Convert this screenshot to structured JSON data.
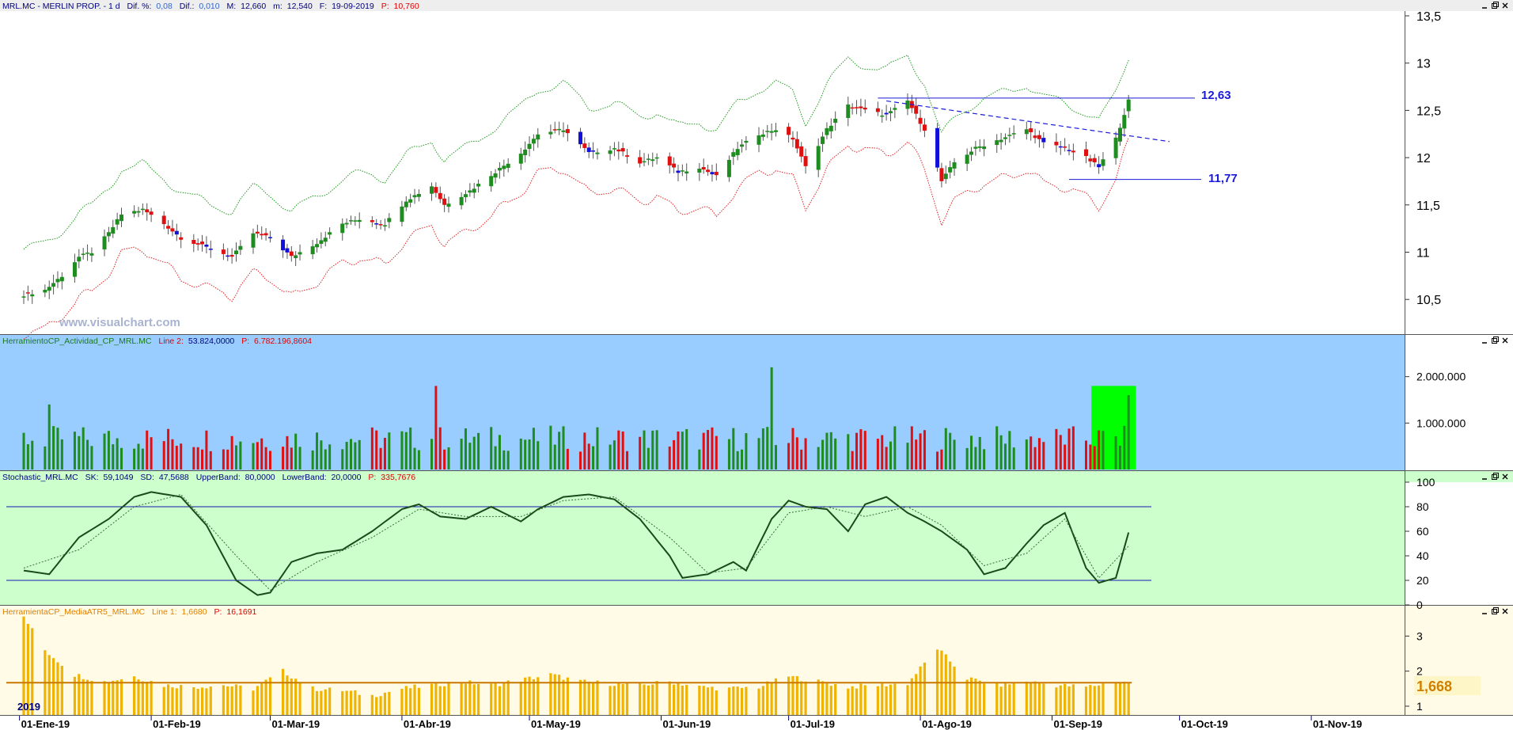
{
  "colors": {
    "up": "#1e8c1e",
    "down": "#e01010",
    "blue_candle": "#1010d8",
    "upper_band": "#1f9a1f",
    "lower_band": "#e02020",
    "trendline": "#1a1ad8",
    "volume_bg": "#99ccff",
    "stoch_bg": "#ccffcc",
    "atr_bg": "#fffbe6",
    "atr_bar": "#f0b400",
    "atr_line": "#c87800",
    "highlight": "#00ff00"
  },
  "icons": [
    "minimize-icon",
    "restore-icon",
    "close-icon"
  ],
  "panels": {
    "price": {
      "header": {
        "symbol": "MRL.MC - MERLIN PROP. - 1 d",
        "dif_pct_label": "Dif. %:",
        "dif_pct": "0,08",
        "dif_label": "Dif.:",
        "dif": "0,010",
        "max_label": "M:",
        "max": "12,660",
        "min_label": "m:",
        "min": "12,540",
        "date_label": "F:",
        "date": "19-09-2019",
        "p_label": "P:",
        "p": "10,760"
      },
      "watermark": "www.visualchart.com",
      "level_high": "12,63",
      "level_low": "11,77"
    },
    "volume": {
      "header": {
        "name": "HerramientoCP_Actividad_CP_MRL.MC",
        "line_label": "Line 2:",
        "line": "53.824,0000",
        "p_label": "P:",
        "p": "6.782.196,8604"
      },
      "ticks": [
        "2.000.000",
        "1.000.000"
      ]
    },
    "stochastic": {
      "header": {
        "name": "Stochastic_MRL.MC",
        "sk_label": "SK:",
        "sk": "59,1049",
        "sd_label": "SD:",
        "sd": "47,5688",
        "ub_label": "UpperBand:",
        "ub": "80,0000",
        "lb_label": "LowerBand:",
        "lb": "20,0000",
        "p_label": "P:",
        "p": "335,7676"
      },
      "ticks": [
        "100",
        "80",
        "60",
        "40",
        "20",
        "0"
      ]
    },
    "atr": {
      "header": {
        "name": "HerramientaCP_MediaATR5_MRL.MC",
        "line_label": "Line 1:",
        "line": "1,6680",
        "p_label": "P:",
        "p": "16,1691"
      },
      "ticks": [
        "3",
        "2",
        "1"
      ],
      "current_value": "1,668",
      "year_label": "2019"
    }
  },
  "x_axis": {
    "labels": [
      "01-Ene-19",
      "01-Feb-19",
      "01-Mar-19",
      "01-Abr-19",
      "01-May-19",
      "01-Jun-19",
      "01-Jul-19",
      "01-Ago-19",
      "01-Sep-19",
      "01-Oct-19",
      "01-Nov-19"
    ]
  },
  "chart_data": [
    {
      "type": "candlestick",
      "panel": "price",
      "y_ticks": [
        "13,5",
        "13",
        "12,5",
        "12",
        "11,5",
        "11",
        "10,5"
      ],
      "ylim": [
        10.15,
        13.5
      ],
      "x_range": [
        "2019-01-02",
        "2019-11-05"
      ],
      "horizontal_levels": [
        12.63,
        11.77
      ],
      "ohlc_points": [
        [
          "2019-01-02",
          10.55
        ],
        [
          "2019-01-07",
          10.6
        ],
        [
          "2019-01-11",
          10.75
        ],
        [
          "2019-01-15",
          10.95
        ],
        [
          "2019-01-18",
          11.0
        ],
        [
          "2019-01-22",
          11.2
        ],
        [
          "2019-01-25",
          11.4
        ],
        [
          "2019-01-30",
          11.45
        ],
        [
          "2019-02-04",
          11.3
        ],
        [
          "2019-02-08",
          11.15
        ],
        [
          "2019-02-14",
          11.05
        ],
        [
          "2019-02-20",
          10.95
        ],
        [
          "2019-02-25",
          11.2
        ],
        [
          "2019-03-01",
          11.15
        ],
        [
          "2019-03-06",
          10.95
        ],
        [
          "2019-03-12",
          11.1
        ],
        [
          "2019-03-18",
          11.3
        ],
        [
          "2019-03-22",
          11.35
        ],
        [
          "2019-03-28",
          11.3
        ],
        [
          "2019-04-02",
          11.55
        ],
        [
          "2019-04-08",
          11.7
        ],
        [
          "2019-04-11",
          11.5
        ],
        [
          "2019-04-17",
          11.65
        ],
        [
          "2019-04-23",
          11.85
        ],
        [
          "2019-04-29",
          12.05
        ],
        [
          "2019-05-03",
          12.25
        ],
        [
          "2019-05-09",
          12.3
        ],
        [
          "2019-05-15",
          12.05
        ],
        [
          "2019-05-21",
          12.1
        ],
        [
          "2019-05-27",
          11.95
        ],
        [
          "2019-05-31",
          12.0
        ],
        [
          "2019-06-05",
          11.85
        ],
        [
          "2019-06-10",
          11.9
        ],
        [
          "2019-06-14",
          11.8
        ],
        [
          "2019-06-19",
          12.1
        ],
        [
          "2019-06-24",
          12.25
        ],
        [
          "2019-06-28",
          12.3
        ],
        [
          "2019-07-02",
          12.2
        ],
        [
          "2019-07-05",
          11.9
        ],
        [
          "2019-07-10",
          12.3
        ],
        [
          "2019-07-15",
          12.55
        ],
        [
          "2019-07-19",
          12.5
        ],
        [
          "2019-07-24",
          12.45
        ],
        [
          "2019-07-29",
          12.6
        ],
        [
          "2019-08-02",
          12.3
        ],
        [
          "2019-08-06",
          11.75
        ],
        [
          "2019-08-09",
          11.95
        ],
        [
          "2019-08-14",
          12.1
        ],
        [
          "2019-08-20",
          12.2
        ],
        [
          "2019-08-26",
          12.3
        ],
        [
          "2019-08-30",
          12.15
        ],
        [
          "2019-09-04",
          12.1
        ],
        [
          "2019-09-09",
          12.0
        ],
        [
          "2019-09-12",
          11.9
        ],
        [
          "2019-09-16",
          12.2
        ],
        [
          "2019-09-19",
          12.6
        ]
      ],
      "last_bar": {
        "date": "2019-09-19",
        "high": 12.66,
        "low": 12.54
      }
    },
    {
      "type": "bar",
      "panel": "volume",
      "ylim": [
        0,
        3000000
      ],
      "y_ticks": [
        2000000,
        1000000
      ],
      "typical_volume": 700000,
      "notable_spikes": [
        {
          "date": "2019-06-27",
          "value": 2200000
        },
        {
          "date": "2019-04-09",
          "value": 1800000
        },
        {
          "date": "2019-01-08",
          "value": 1400000
        }
      ],
      "highlight_range": [
        "2019-09-11",
        "2019-09-20"
      ],
      "last_value": 1600000
    },
    {
      "type": "line",
      "panel": "stochastic",
      "ylim": [
        0,
        100
      ],
      "bands": [
        80,
        20
      ],
      "series": [
        {
          "name": "SK",
          "points": [
            [
              "2019-01-02",
              28
            ],
            [
              "2019-01-08",
              25
            ],
            [
              "2019-01-15",
              55
            ],
            [
              "2019-01-22",
              70
            ],
            [
              "2019-01-28",
              88
            ],
            [
              "2019-02-01",
              92
            ],
            [
              "2019-02-08",
              88
            ],
            [
              "2019-02-14",
              65
            ],
            [
              "2019-02-21",
              20
            ],
            [
              "2019-02-26",
              8
            ],
            [
              "2019-03-01",
              10
            ],
            [
              "2019-03-06",
              35
            ],
            [
              "2019-03-12",
              42
            ],
            [
              "2019-03-18",
              45
            ],
            [
              "2019-03-25",
              60
            ],
            [
              "2019-04-01",
              78
            ],
            [
              "2019-04-05",
              82
            ],
            [
              "2019-04-10",
              72
            ],
            [
              "2019-04-16",
              70
            ],
            [
              "2019-04-22",
              80
            ],
            [
              "2019-04-29",
              68
            ],
            [
              "2019-05-03",
              78
            ],
            [
              "2019-05-09",
              88
            ],
            [
              "2019-05-15",
              90
            ],
            [
              "2019-05-21",
              86
            ],
            [
              "2019-05-27",
              70
            ],
            [
              "2019-06-03",
              40
            ],
            [
              "2019-06-06",
              22
            ],
            [
              "2019-06-12",
              25
            ],
            [
              "2019-06-18",
              35
            ],
            [
              "2019-06-21",
              28
            ],
            [
              "2019-06-27",
              70
            ],
            [
              "2019-07-01",
              85
            ],
            [
              "2019-07-05",
              80
            ],
            [
              "2019-07-10",
              78
            ],
            [
              "2019-07-15",
              60
            ],
            [
              "2019-07-19",
              82
            ],
            [
              "2019-07-24",
              88
            ],
            [
              "2019-07-29",
              75
            ],
            [
              "2019-08-02",
              68
            ],
            [
              "2019-08-06",
              60
            ],
            [
              "2019-08-12",
              45
            ],
            [
              "2019-08-16",
              25
            ],
            [
              "2019-08-21",
              30
            ],
            [
              "2019-08-26",
              50
            ],
            [
              "2019-08-30",
              65
            ],
            [
              "2019-09-04",
              75
            ],
            [
              "2019-09-09",
              30
            ],
            [
              "2019-09-12",
              18
            ],
            [
              "2019-09-16",
              22
            ],
            [
              "2019-09-19",
              59
            ]
          ]
        },
        {
          "name": "SD",
          "points": [
            [
              "2019-01-02",
              30
            ],
            [
              "2019-01-15",
              45
            ],
            [
              "2019-01-28",
              80
            ],
            [
              "2019-02-08",
              90
            ],
            [
              "2019-02-21",
              40
            ],
            [
              "2019-03-01",
              12
            ],
            [
              "2019-03-12",
              35
            ],
            [
              "2019-03-25",
              55
            ],
            [
              "2019-04-05",
              78
            ],
            [
              "2019-04-16",
              72
            ],
            [
              "2019-04-29",
              72
            ],
            [
              "2019-05-09",
              85
            ],
            [
              "2019-05-21",
              88
            ],
            [
              "2019-06-03",
              55
            ],
            [
              "2019-06-12",
              26
            ],
            [
              "2019-06-21",
              30
            ],
            [
              "2019-07-01",
              75
            ],
            [
              "2019-07-10",
              80
            ],
            [
              "2019-07-19",
              72
            ],
            [
              "2019-07-29",
              80
            ],
            [
              "2019-08-06",
              65
            ],
            [
              "2019-08-16",
              32
            ],
            [
              "2019-08-26",
              42
            ],
            [
              "2019-09-04",
              70
            ],
            [
              "2019-09-12",
              22
            ],
            [
              "2019-09-19",
              48
            ]
          ]
        }
      ]
    },
    {
      "type": "bar",
      "panel": "atr",
      "ylim": [
        0.75,
        3.55
      ],
      "y_ticks": [
        3,
        2,
        1
      ],
      "average_line": 1.67,
      "bars": [
        [
          "2019-01-02",
          3.55
        ],
        [
          "2019-01-07",
          2.6
        ],
        [
          "2019-01-14",
          1.9
        ],
        [
          "2019-01-21",
          1.7
        ],
        [
          "2019-01-28",
          1.85
        ],
        [
          "2019-02-04",
          1.6
        ],
        [
          "2019-02-11",
          1.55
        ],
        [
          "2019-02-18",
          1.6
        ],
        [
          "2019-02-25",
          1.5
        ],
        [
          "2019-03-04",
          2.0
        ],
        [
          "2019-03-11",
          1.5
        ],
        [
          "2019-03-18",
          1.45
        ],
        [
          "2019-03-25",
          1.3
        ],
        [
          "2019-04-01",
          1.5
        ],
        [
          "2019-04-08",
          1.6
        ],
        [
          "2019-04-15",
          1.7
        ],
        [
          "2019-04-22",
          1.6
        ],
        [
          "2019-04-29",
          1.75
        ],
        [
          "2019-05-06",
          1.9
        ],
        [
          "2019-05-13",
          1.7
        ],
        [
          "2019-05-20",
          1.65
        ],
        [
          "2019-05-27",
          1.6
        ],
        [
          "2019-06-03",
          1.7
        ],
        [
          "2019-06-10",
          1.55
        ],
        [
          "2019-06-17",
          1.5
        ],
        [
          "2019-06-24",
          1.55
        ],
        [
          "2019-07-01",
          1.85
        ],
        [
          "2019-07-08",
          1.7
        ],
        [
          "2019-07-15",
          1.55
        ],
        [
          "2019-07-22",
          1.6
        ],
        [
          "2019-07-29",
          1.65
        ],
        [
          "2019-08-05",
          2.65
        ],
        [
          "2019-08-12",
          1.8
        ],
        [
          "2019-08-19",
          1.6
        ],
        [
          "2019-08-26",
          1.7
        ],
        [
          "2019-09-02",
          1.6
        ],
        [
          "2019-09-09",
          1.55
        ],
        [
          "2019-09-16",
          1.7
        ],
        [
          "2019-09-19",
          1.67
        ]
      ]
    }
  ]
}
